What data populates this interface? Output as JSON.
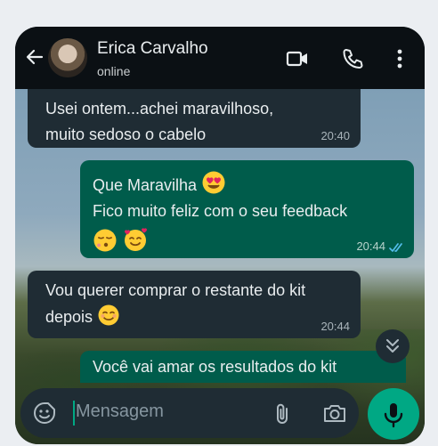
{
  "header": {
    "contact_name": "Erica Carvalho",
    "status": "online"
  },
  "messages": [
    {
      "direction": "in",
      "lines": [
        "Usei ontem...achei maravilhoso,",
        "muito sedoso o cabelo"
      ],
      "time": "20:40"
    },
    {
      "direction": "out",
      "lines": [
        "Que Maravilha",
        "Fico muito feliz com o seu feedback"
      ],
      "emojis": [
        "heart-eyes",
        "kissing-closed-eyes",
        "smiling-face-with-hearts"
      ],
      "time": "20:44",
      "read": true
    },
    {
      "direction": "in",
      "lines": [
        "Vou querer comprar o restante do kit",
        "depois"
      ],
      "emojis": [
        "smiling-face"
      ],
      "time": "20:44"
    },
    {
      "direction": "out",
      "lines": [
        "Você vai amar os resultados do kit"
      ]
    }
  ],
  "composer": {
    "placeholder": "Mensagem"
  },
  "icons": {
    "back": "back-arrow-icon",
    "video": "video-call-icon",
    "call": "phone-call-icon",
    "menu": "more-options-icon",
    "scroll": "scroll-down-icon",
    "sticker": "sticker-icon",
    "attach": "attach-icon",
    "camera": "camera-icon",
    "mic": "mic-icon"
  },
  "colors": {
    "incoming_bubble": "#1f2c34",
    "outgoing_bubble": "#005c4b",
    "accent": "#00a884",
    "read_ticks": "#53bdeb"
  }
}
